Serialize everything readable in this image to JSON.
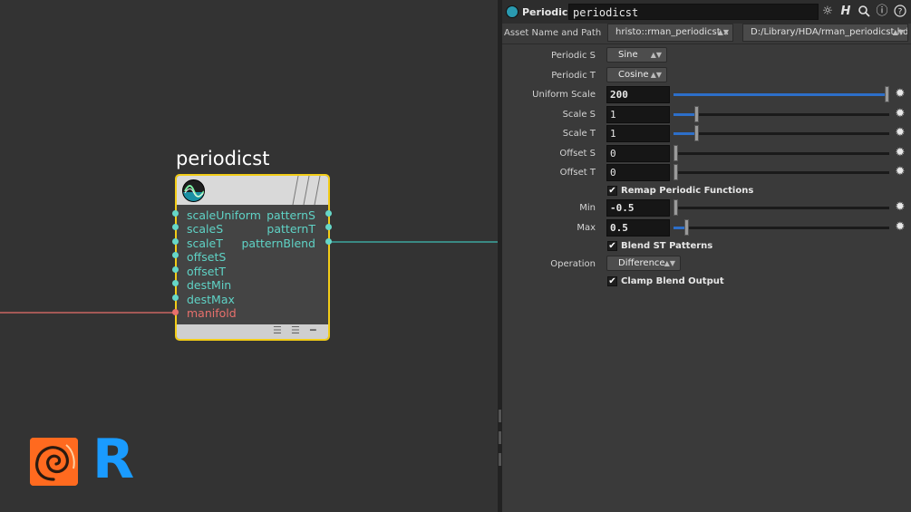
{
  "network": {
    "node_name": "periodicst",
    "inputs": [
      "scaleUniform",
      "scaleS",
      "scaleT",
      "offsetS",
      "offsetT",
      "destMin",
      "destMax"
    ],
    "manifold_input": "manifold",
    "outputs": [
      "patternS",
      "patternT",
      "patternBlend"
    ],
    "footer_glyphs": [
      "☰",
      "☰",
      "━"
    ],
    "logo_r": "R",
    "colors": {
      "selection": "#f2cc17",
      "port": "#5fd3c6",
      "manifold": "#e8706c",
      "wire_out": "#3fbfb4"
    }
  },
  "panel": {
    "node_type": "Periodic ST",
    "node_name_value": "periodicst",
    "toolbar_icons": [
      "☼",
      "H",
      "🔍",
      "ⓘ",
      "?"
    ],
    "asset_label": "Asset Name and Path",
    "asset_name": "hristo::rman_periodicst...",
    "asset_path": "D:/Library/HDA/rman_periodicst.hda",
    "params": {
      "periodic_s": {
        "label": "Periodic S",
        "value": "Sine"
      },
      "periodic_t": {
        "label": "Periodic T",
        "value": "Cosine"
      },
      "uniform_scale": {
        "label": "Uniform Scale",
        "value": "200",
        "level": 1.0
      },
      "scale_s": {
        "label": "Scale S",
        "value": "1",
        "level": 0.1
      },
      "scale_t": {
        "label": "Scale T",
        "value": "1",
        "level": 0.1
      },
      "offset_s": {
        "label": "Offset S",
        "value": "0",
        "level": 0.0
      },
      "offset_t": {
        "label": "Offset T",
        "value": "0",
        "level": 0.0
      },
      "remap": {
        "label": "Remap Periodic Functions",
        "checked": true
      },
      "min": {
        "label": "Min",
        "value": "-0.5",
        "level": 0.0
      },
      "max": {
        "label": "Max",
        "value": "0.5",
        "level": 0.05
      },
      "blend": {
        "label": "Blend ST Patterns",
        "checked": true
      },
      "operation": {
        "label": "Operation",
        "value": "Difference"
      },
      "clamp": {
        "label": "Clamp Blend Output",
        "checked": true
      }
    },
    "gear_icon": "✹",
    "check_glyph": "✔",
    "menu_arrow": "▲▼",
    "accent": "#2d6fc9"
  }
}
